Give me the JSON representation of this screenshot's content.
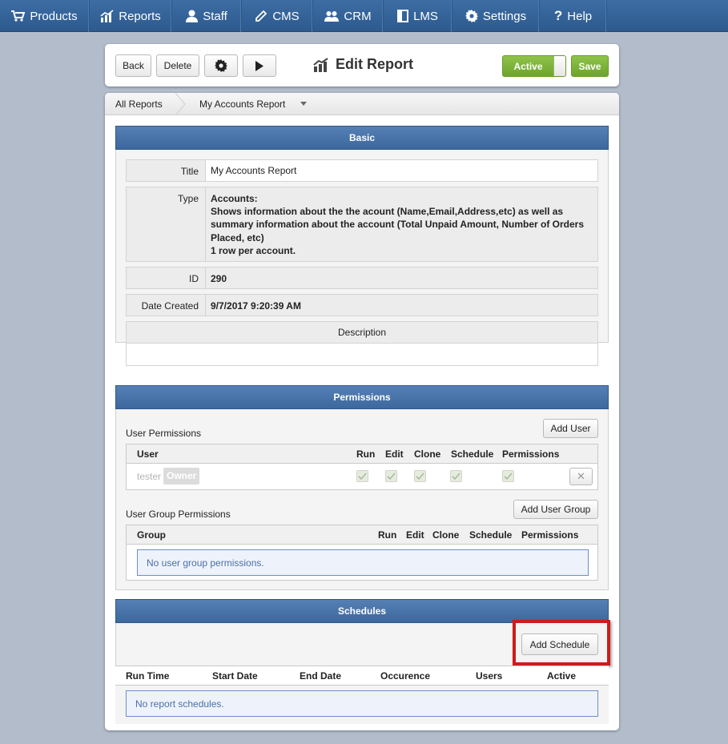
{
  "nav": {
    "items": [
      {
        "label": "Products",
        "icon": "cart-icon"
      },
      {
        "label": "Reports",
        "icon": "chart-icon"
      },
      {
        "label": "Staff",
        "icon": "user-icon"
      },
      {
        "label": "CMS",
        "icon": "pencil-icon"
      },
      {
        "label": "CRM",
        "icon": "users-icon"
      },
      {
        "label": "LMS",
        "icon": "book-icon"
      },
      {
        "label": "Settings",
        "icon": "gear-icon"
      },
      {
        "label": "Help",
        "icon": "question-icon"
      }
    ]
  },
  "toolbar": {
    "back_label": "Back",
    "delete_label": "Delete",
    "title": "Edit Report",
    "active_label": "Active",
    "save_label": "Save"
  },
  "breadcrumb": {
    "root": "All Reports",
    "current": "My Accounts Report"
  },
  "basic": {
    "heading": "Basic",
    "title_label": "Title",
    "title_value": "My Accounts Report",
    "type_label": "Type",
    "type_lines": [
      "Accounts:",
      "Shows information about the the acount (Name,Email,Address,etc) as well as",
      "summary information about the account (Total Unpaid Amount, Number of Orders",
      "Placed, etc)",
      "1 row per account."
    ],
    "id_label": "ID",
    "id_value": "290",
    "date_label": "Date Created",
    "date_value": "9/7/2017 9:20:39 AM",
    "description_label": "Description",
    "description_value": ""
  },
  "permissions": {
    "heading": "Permissions",
    "user_section_label": "User Permissions",
    "add_user_label": "Add User",
    "user_columns": [
      "User",
      "Run",
      "Edit",
      "Clone",
      "Schedule",
      "Permissions"
    ],
    "user_rows": [
      {
        "user": "tester",
        "badge": "Owner",
        "run": true,
        "edit": true,
        "clone": true,
        "schedule": true,
        "permissions": true
      }
    ],
    "group_section_label": "User Group Permissions",
    "add_group_label": "Add User Group",
    "group_columns": [
      "Group",
      "Run",
      "Edit",
      "Clone",
      "Schedule",
      "Permissions"
    ],
    "group_empty": "No user group permissions."
  },
  "schedules": {
    "heading": "Schedules",
    "add_label": "Add Schedule",
    "columns": [
      "Run Time",
      "Start Date",
      "End Date",
      "Occurence",
      "Users",
      "Active"
    ],
    "empty": "No report schedules."
  },
  "colors": {
    "nav_bg": "#3565a0",
    "panel_head": "#4a75ab",
    "accent_green": "#7cb13a",
    "highlight_red": "#cc1c1c",
    "empty_text": "#4b6fa8"
  }
}
